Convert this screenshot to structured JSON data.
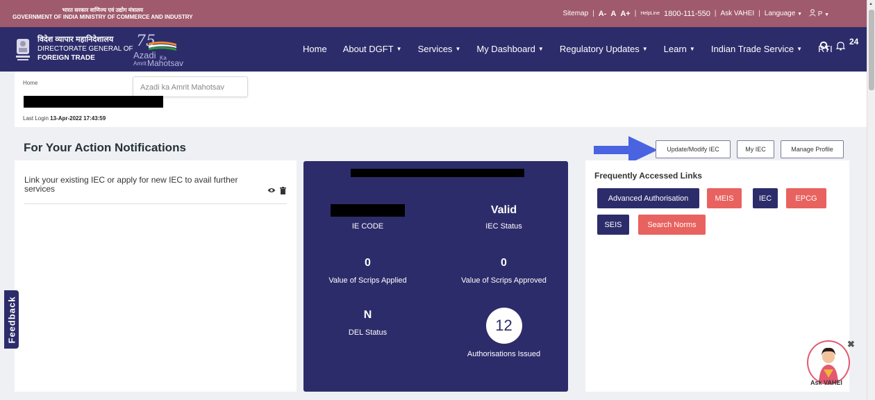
{
  "topbar": {
    "gov_hindi": "भारत सरकार   वाणिज्य एवं उद्योग मंत्रालय",
    "gov_english": "GOVERNMENT OF INDIA  MINISTRY OF COMMERCE AND INDUSTRY",
    "sitemap": "Sitemap",
    "font_small": "A-",
    "font_normal": "A",
    "font_large": "A+",
    "helpline_label": "HelpLine",
    "helpline_number": "1800-111-550",
    "ask_vahei": "Ask VAHEI",
    "language": "Language",
    "user": "P",
    "separator": "|"
  },
  "navbar": {
    "org_hindi": "विदेश व्यापार महानिदेशालय",
    "org_line1": "DIRECTORATE GENERAL OF",
    "org_line2": "FOREIGN TRADE",
    "azadi_75": "75",
    "azadi_word": "Azadi",
    "azadi_ka": "Ka",
    "azadi_amrit": "Amrit",
    "azadi_mahotsav": "Mahotsav",
    "menu": [
      "Home",
      "About DGFT",
      "Services",
      "My Dashboard",
      "Regulatory Updates",
      "Learn",
      "Indian Trade Service",
      "RTI"
    ],
    "bell_count": "24"
  },
  "breadcrumb": {
    "home": "Home",
    "tooltip": "Azadi ka Amrit Mahotsav",
    "last_login_label": "Last Login",
    "last_login_value": "13-Apr-2022 17:43:59"
  },
  "section": {
    "title": "For Your Action Notifications",
    "buttons": {
      "update_iec": "Update/Modify IEC",
      "my_iec": "My IEC",
      "manage_profile": "Manage Profile"
    }
  },
  "notification": {
    "text": "Link your existing IEC or apply for new IEC to avail further services"
  },
  "stats": {
    "ie_code_label": "IE CODE",
    "iec_status_value": "Valid",
    "iec_status_label": "IEC Status",
    "scrips_applied_value": "0",
    "scrips_applied_label": "Value of Scrips Applied",
    "scrips_approved_value": "0",
    "scrips_approved_label": "Value of Scrips Approved",
    "del_status_value": "N",
    "del_status_label": "DEL Status",
    "authorisations_value": "12",
    "authorisations_label": "Authorisations Issued"
  },
  "links": {
    "title": "Frequently Accessed Links",
    "items": [
      "Advanced Authorisation",
      "MEIS",
      "IEC",
      "EPCG",
      "SEIS",
      "Search Norms"
    ]
  },
  "feedback": "Feedback",
  "vahei_label": "Ask VAHEI",
  "colors": {
    "topbar": "#a05a6e",
    "navy": "#2d2c6b",
    "coral": "#e8625f",
    "background": "#eef0f4",
    "arrow": "#4a63e0"
  },
  "icons": [
    "search-icon",
    "bell-icon",
    "user-icon",
    "eye-icon",
    "trash-icon",
    "close-icon",
    "caret-down-icon"
  ]
}
